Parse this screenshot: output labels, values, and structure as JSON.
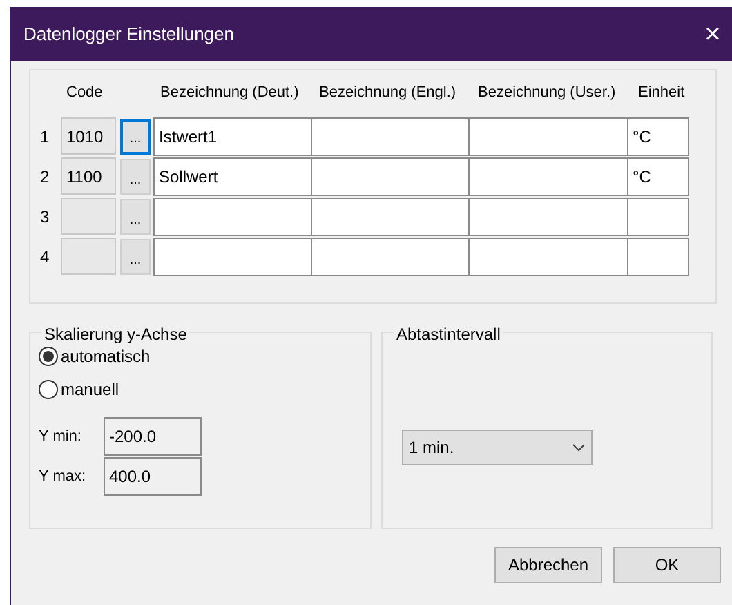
{
  "window": {
    "title": "Datenlogger Einstellungen",
    "close": "×"
  },
  "table": {
    "columns": [
      "Code",
      "Bezeichnung (Deut.)",
      "Bezeichnung (Engl.)",
      "Bezeichnung (User.)",
      "Einheit"
    ],
    "rows": [
      {
        "number": "1",
        "code": "1010",
        "button": "...",
        "focused": true,
        "deut": "Istwert1",
        "unit": "°C"
      },
      {
        "number": "2",
        "code": "1100",
        "button": "...",
        "focused": false,
        "deut": "Sollwert",
        "unit": "°C"
      },
      {
        "number": "3",
        "button": "...",
        "focused": false
      },
      {
        "number": "4",
        "button": "...",
        "focused": false
      }
    ]
  },
  "scaling": {
    "title": "Skalierung y-Achse",
    "options": [
      {
        "label": "automatisch",
        "selected": true
      },
      {
        "label": "manuell",
        "selected": false
      }
    ],
    "fields": [
      {
        "label": "Y min:",
        "value": "-200.0"
      },
      {
        "label": "Y max:",
        "value": "400.0"
      }
    ]
  },
  "interval": {
    "title": "Abtastintervall",
    "value": "1 min."
  },
  "buttons": [
    "Abbrechen",
    "OK"
  ]
}
